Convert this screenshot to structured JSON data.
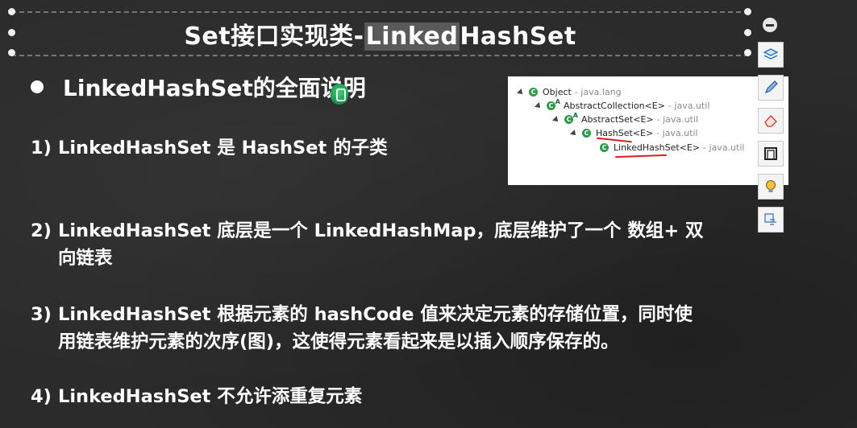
{
  "slide": {
    "title_prefix": "Set接口实现类-",
    "title_highlight": "Linked",
    "title_suffix": "HashSet",
    "heading": "LinkedHashSet的全面说明",
    "points": [
      {
        "num": "1)",
        "line1": "LinkedHashSet 是 HashSet 的子类",
        "line2": ""
      },
      {
        "num": "2)",
        "line1": "LinkedHashSet 底层是一个 LinkedHashMap，底层维护了一个 数组+ 双",
        "line2": "向链表"
      },
      {
        "num": "3)",
        "line1": "LinkedHashSet 根据元素的 hashCode 值来决定元素的存储位置，同时使",
        "line2": "用链表维护元素的次序(图)，这使得元素看起来是以插入顺序保存的。"
      },
      {
        "num": "4)",
        "line1": "LinkedHashSet 不允许添重复元素",
        "line2": ""
      }
    ]
  },
  "hierarchy": {
    "nodes": [
      {
        "name": "Object",
        "pkg": "- java.lang"
      },
      {
        "name": "AbstractCollection<E>",
        "pkg": "- java.util"
      },
      {
        "name": "AbstractSet<E>",
        "pkg": "- java.util"
      },
      {
        "name": "HashSet<E>",
        "pkg": "- java.util"
      },
      {
        "name": "LinkedHashSet<E>",
        "pkg": "- java.util"
      }
    ],
    "class_glyph": "C",
    "abstract_glyph": "A"
  },
  "toolbar": {
    "tools": [
      "layers-icon",
      "pen-icon",
      "eraser-icon",
      "frame-icon",
      "lightbulb-icon",
      "text-translate-icon"
    ]
  },
  "colors": {
    "background": "#2b2b2b",
    "text": "#ffffff",
    "class_icon": "#2e9a48",
    "underline": "#d81e1e"
  }
}
